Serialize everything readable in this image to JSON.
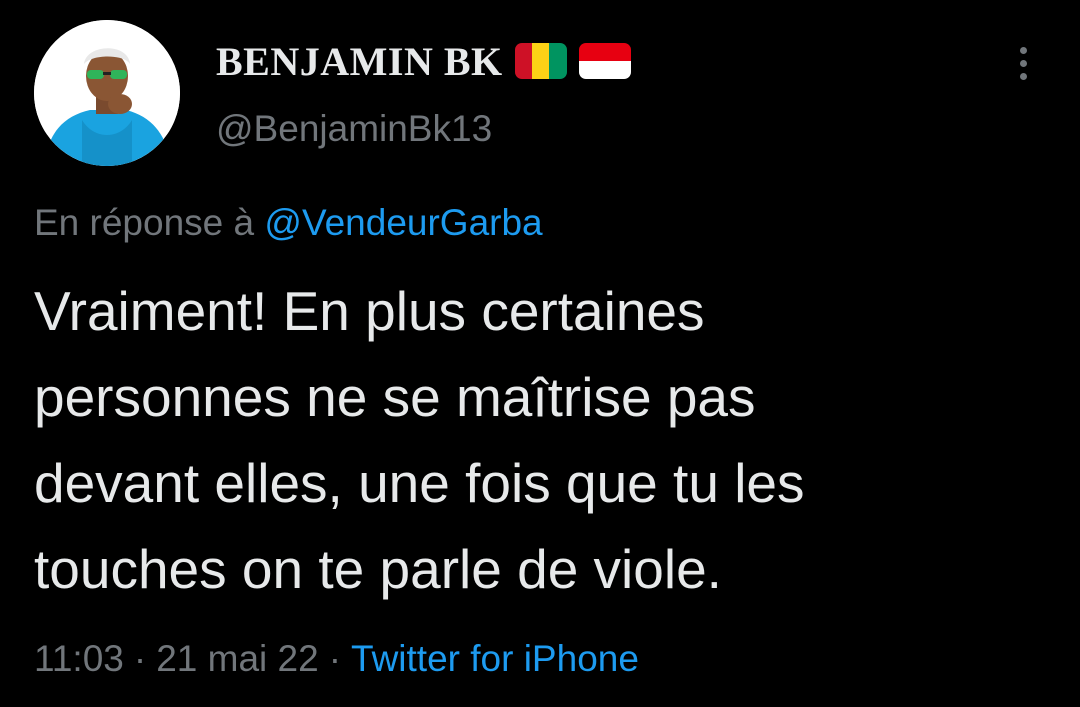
{
  "user": {
    "display_name": "BENJAMIN BK",
    "handle": "@BenjaminBk13",
    "flags": [
      "guinea-flag",
      "indonesia-flag"
    ],
    "avatar_icon": "profile-photo"
  },
  "reply": {
    "prefix": "En réponse à",
    "to_handle": "@VendeurGarba"
  },
  "tweet": {
    "lines": [
      "Vraiment! En plus certaines",
      "personnes ne se maîtrise pas",
      "devant elles, une fois que tu les",
      "touches on te parle de viole."
    ]
  },
  "meta": {
    "time": "11:03",
    "separator": "·",
    "date": "21 mai 22",
    "source": "Twitter for iPhone"
  },
  "icons": {
    "more": "more-vertical-icon"
  },
  "colors": {
    "background": "#000000",
    "text": "#e7e9ea",
    "secondary": "#71767b",
    "link": "#1d9bf0"
  }
}
